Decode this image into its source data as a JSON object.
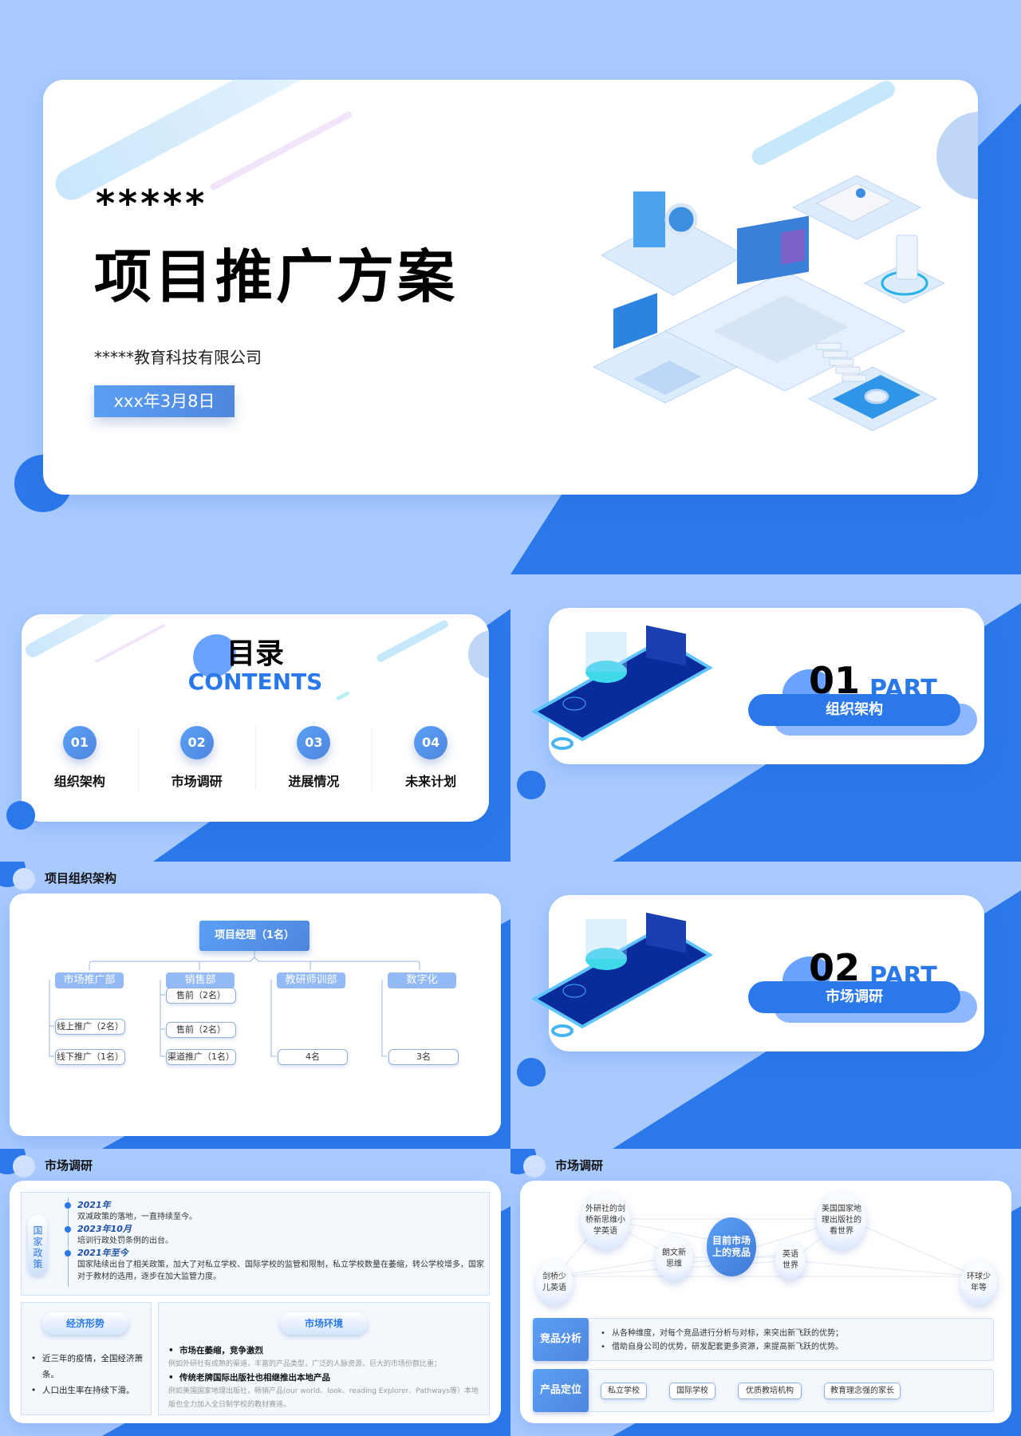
{
  "colors": {
    "primary": "#2a78ea",
    "light_bg": "#a9caff",
    "accent_text": "#2a78ea"
  },
  "title_slide": {
    "stars": "*****",
    "title": "项目推广方案",
    "company": "*****教育科技有限公司",
    "date": "xxx年3月8日",
    "illustration": "isometric-tech-illustration"
  },
  "toc": {
    "title": "目录",
    "subtitle": "CONTENTS",
    "items": [
      {
        "num": "01",
        "label": "组织架构"
      },
      {
        "num": "02",
        "label": "市场调研"
      },
      {
        "num": "03",
        "label": "进展情况"
      },
      {
        "num": "04",
        "label": "未来计划"
      }
    ]
  },
  "part1": {
    "num": "01",
    "word": "PART",
    "label": "组织架构"
  },
  "part2": {
    "num": "02",
    "word": "PART",
    "label": "市场调研"
  },
  "org": {
    "header": "项目组织架构",
    "manager": "项目经理（1名）",
    "departments": [
      {
        "name": "市场推广部",
        "members": [
          "线上推广（2名）",
          "线下推广（1名）"
        ]
      },
      {
        "name": "销售部",
        "members": [
          "售前（2名）",
          "售前（2名）",
          "渠道推广（1名）"
        ]
      },
      {
        "name": "教研师训部",
        "members": [
          "4名"
        ]
      },
      {
        "name": "数字化",
        "members": [
          "3名"
        ]
      }
    ]
  },
  "research1": {
    "header": "市场调研",
    "policy_tag": "国家政策",
    "timeline": [
      {
        "year": "2021年",
        "text": "双减政策的落地，一直持续至今。"
      },
      {
        "year": "2023年10月",
        "text": "培训行政处罚条例的出台。"
      },
      {
        "year": "2021年至今",
        "text": "国家陆续出台了相关政策，加大了对私立学校、国际学校的监管和限制，私立学校数量在萎缩，转公学校增多，国家对于教材的选用，逐步在加大监管力度。"
      }
    ],
    "economy": {
      "title": "经济形势",
      "items": [
        "近三年的疫情，全国经济萧条。",
        "人口出生率在持续下滑。"
      ]
    },
    "market": {
      "title": "市场环境",
      "points": [
        {
          "head": "市场在萎缩，竞争激烈",
          "detail": "例如外研社有成熟的渠道，丰富的产品类型，广泛的人脉资源，巨大的市场份额比重；"
        },
        {
          "head": "传统老牌国际出版社也相继推出本地产品",
          "detail": "例如美国国家地理出版社，畅销产品(our world、look、reading Explorer、Pathways等）本地版也全力加入全日制学校的教材赛道。"
        }
      ]
    }
  },
  "research2": {
    "header": "市场调研",
    "center": "目前市场上的竞品",
    "competitors": [
      "外研社的剑桥新思维小学英语",
      "朗文新思维",
      "剑桥少儿英语",
      "美国国家地理出版社的看世界",
      "英语世界",
      "环球少年等"
    ],
    "analysis": {
      "tag": "竞品分析",
      "items": [
        "从各种维度，对每个竞品进行分析与对标，来突出新飞跃的优势；",
        "借助自身公司的优势，研发配套更多资源，来提高新飞跃的优势。"
      ]
    },
    "positioning": {
      "tag": "产品定位",
      "items": [
        "私立学校",
        "国际学校",
        "优质教培机构",
        "教育理念强的家长"
      ]
    }
  }
}
